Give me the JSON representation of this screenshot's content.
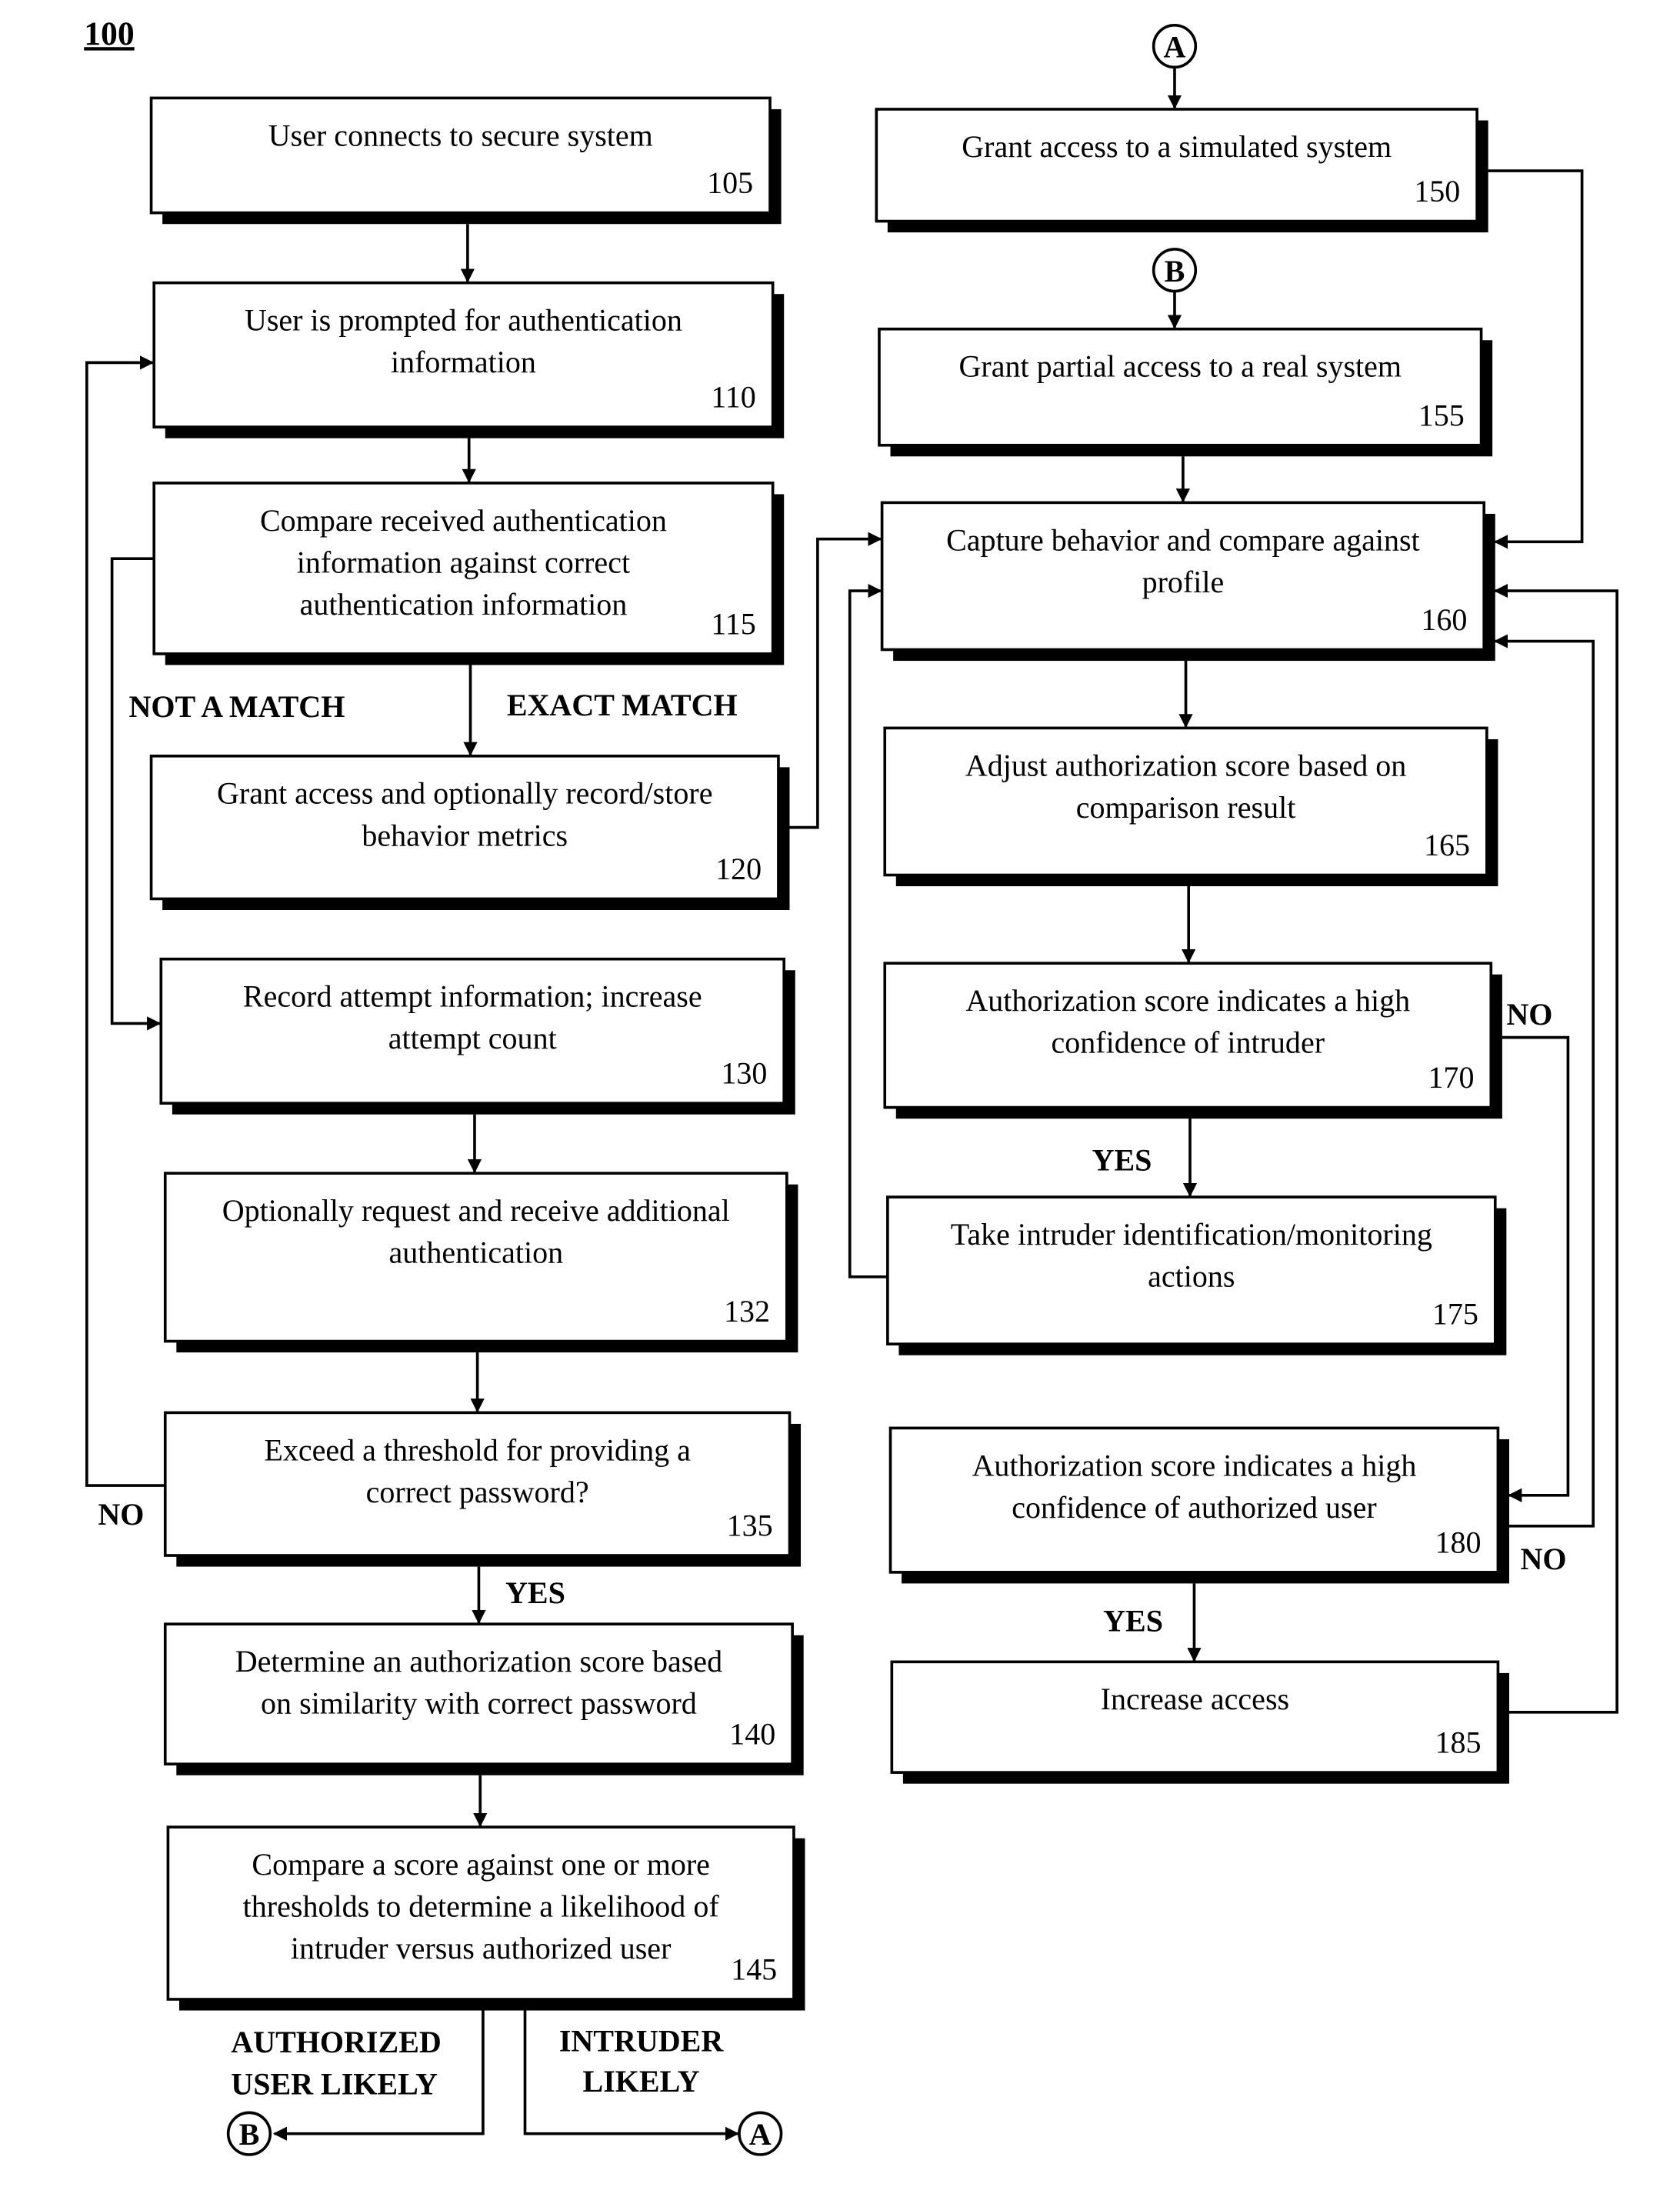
{
  "figure_label": "100",
  "steps": {
    "s105": {
      "lines": [
        "User connects to secure system"
      ],
      "ref": "105"
    },
    "s110": {
      "lines": [
        "User is prompted for authentication",
        "information"
      ],
      "ref": "110"
    },
    "s115": {
      "lines": [
        "Compare received authentication",
        "information against correct",
        "authentication information"
      ],
      "ref": "115"
    },
    "s120": {
      "lines": [
        "Grant access and optionally record/store",
        "behavior metrics"
      ],
      "ref": "120"
    },
    "s130": {
      "lines": [
        "Record attempt information; increase",
        "attempt count"
      ],
      "ref": "130"
    },
    "s132": {
      "lines": [
        "Optionally request and receive additional",
        "authentication"
      ],
      "ref": "132"
    },
    "s135": {
      "lines": [
        "Exceed a threshold for providing a",
        "correct password?"
      ],
      "ref": "135"
    },
    "s140": {
      "lines": [
        "Determine an authorization score based",
        "on similarity with correct password"
      ],
      "ref": "140"
    },
    "s145": {
      "lines": [
        "Compare a score against one or more",
        "thresholds to determine a likelihood of",
        "intruder versus authorized user"
      ],
      "ref": "145"
    },
    "s150": {
      "lines": [
        "Grant access to a simulated system"
      ],
      "ref": "150"
    },
    "s155": {
      "lines": [
        "Grant partial access to a real system"
      ],
      "ref": "155"
    },
    "s160": {
      "lines": [
        "Capture behavior and compare against",
        "profile"
      ],
      "ref": "160"
    },
    "s165": {
      "lines": [
        "Adjust authorization score based on",
        "comparison result"
      ],
      "ref": "165"
    },
    "s170": {
      "lines": [
        "Authorization score indicates a high",
        "confidence of intruder"
      ],
      "ref": "170"
    },
    "s175": {
      "lines": [
        "Take intruder identification/monitoring",
        "actions"
      ],
      "ref": "175"
    },
    "s180": {
      "lines": [
        "Authorization score indicates a high",
        "confidence of authorized user"
      ],
      "ref": "180"
    },
    "s185": {
      "lines": [
        "Increase access"
      ],
      "ref": "185"
    }
  },
  "edge_labels": {
    "not_a_match": "NOT A MATCH",
    "exact_match": "EXACT MATCH",
    "no_135": "NO",
    "yes_135": "YES",
    "authorized_user_likely": [
      "AUTHORIZED",
      "USER LIKELY"
    ],
    "intruder_likely": [
      "INTRUDER",
      "LIKELY"
    ],
    "no_170": "NO",
    "yes_170": "YES",
    "no_180": "NO",
    "yes_180": "YES"
  },
  "connectors": {
    "a": "A",
    "b": "B"
  }
}
